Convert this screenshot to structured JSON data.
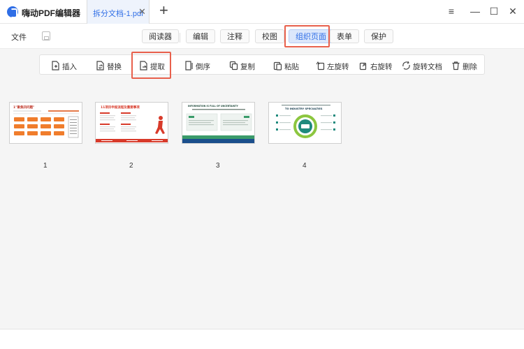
{
  "app": {
    "title": "嗨动PDF编辑器"
  },
  "doc_tab": {
    "label": "拆分文档-1.pdf",
    "close_glyph": "✕"
  },
  "new_tab_glyph": "+",
  "window_controls": {
    "menu": "≡",
    "minimize": "—",
    "maximize": "☐",
    "close": "✕"
  },
  "menubar": {
    "file_label": "文件",
    "tabs": [
      {
        "label": "阅读器",
        "active": false
      },
      {
        "label": "编辑",
        "active": false
      },
      {
        "label": "注释",
        "active": false
      },
      {
        "label": "校图",
        "active": false
      },
      {
        "label": "组织页面",
        "active": true
      },
      {
        "label": "表单",
        "active": false
      },
      {
        "label": "保护",
        "active": false
      }
    ]
  },
  "toolbar": {
    "items": [
      {
        "label": "插入",
        "icon": "insert-page-icon"
      },
      {
        "label": "替换",
        "icon": "replace-page-icon"
      },
      {
        "label": "提取",
        "icon": "extract-page-icon"
      },
      {
        "label": "倒序",
        "icon": "reverse-order-icon"
      },
      {
        "label": "复制",
        "icon": "copy-icon"
      },
      {
        "label": "粘贴",
        "icon": "paste-icon"
      },
      {
        "label": "左旋转",
        "icon": "rotate-left-icon"
      },
      {
        "label": "右旋转",
        "icon": "rotate-right-icon"
      },
      {
        "label": "旋转文档",
        "icon": "rotate-document-icon"
      },
      {
        "label": "删除",
        "icon": "trash-icon"
      }
    ]
  },
  "pages": [
    {
      "number": "1",
      "heading": "1\"聚焦四问题\""
    },
    {
      "number": "2",
      "heading": "11项目申报流程及重要事项"
    },
    {
      "number": "3",
      "heading": "INFORMATION IS FULL OF UNCERTAINTY"
    },
    {
      "number": "4",
      "heading": "TO INDUSTRY SPECIALTIES"
    }
  ],
  "colors": {
    "accent": "#2f6ee6",
    "highlight": "#e8604c",
    "page1_orange": "#f07d2c",
    "page2_red": "#d83a2a",
    "page3_green": "#3a9b6a",
    "page4_teal": "#1f8a7d"
  }
}
